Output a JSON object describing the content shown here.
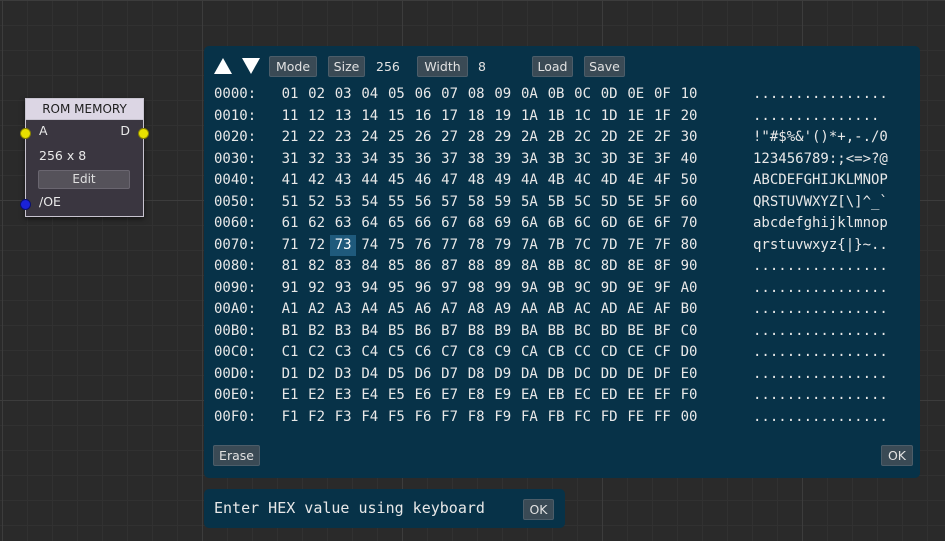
{
  "rom_node": {
    "title": "ROM MEMORY",
    "pin_a": "A",
    "pin_d": "D",
    "size_label": "256 x 8",
    "edit_button": "Edit",
    "pin_oe": "/OE"
  },
  "toolbar": {
    "mode_button": "Mode",
    "size_button": "Size",
    "size_value": "256",
    "width_button": "Width",
    "width_value": "8",
    "load_button": "Load",
    "save_button": "Save"
  },
  "hex_rows": [
    {
      "addr": "0000:",
      "bytes": [
        "01",
        "02",
        "03",
        "04",
        "05",
        "06",
        "07",
        "08",
        "09",
        "0A",
        "0B",
        "0C",
        "0D",
        "0E",
        "0F",
        "10"
      ],
      "ascii": "................"
    },
    {
      "addr": "0010:",
      "bytes": [
        "11",
        "12",
        "13",
        "14",
        "15",
        "16",
        "17",
        "18",
        "19",
        "1A",
        "1B",
        "1C",
        "1D",
        "1E",
        "1F",
        "20"
      ],
      "ascii": "............... "
    },
    {
      "addr": "0020:",
      "bytes": [
        "21",
        "22",
        "23",
        "24",
        "25",
        "26",
        "27",
        "28",
        "29",
        "2A",
        "2B",
        "2C",
        "2D",
        "2E",
        "2F",
        "30"
      ],
      "ascii": "!\"#$%&'()*+,-./0"
    },
    {
      "addr": "0030:",
      "bytes": [
        "31",
        "32",
        "33",
        "34",
        "35",
        "36",
        "37",
        "38",
        "39",
        "3A",
        "3B",
        "3C",
        "3D",
        "3E",
        "3F",
        "40"
      ],
      "ascii": "123456789:;<=>?@"
    },
    {
      "addr": "0040:",
      "bytes": [
        "41",
        "42",
        "43",
        "44",
        "45",
        "46",
        "47",
        "48",
        "49",
        "4A",
        "4B",
        "4C",
        "4D",
        "4E",
        "4F",
        "50"
      ],
      "ascii": "ABCDEFGHIJKLMNOP"
    },
    {
      "addr": "0050:",
      "bytes": [
        "51",
        "52",
        "53",
        "54",
        "55",
        "56",
        "57",
        "58",
        "59",
        "5A",
        "5B",
        "5C",
        "5D",
        "5E",
        "5F",
        "60"
      ],
      "ascii": "QRSTUVWXYZ[\\]^_`"
    },
    {
      "addr": "0060:",
      "bytes": [
        "61",
        "62",
        "63",
        "64",
        "65",
        "66",
        "67",
        "68",
        "69",
        "6A",
        "6B",
        "6C",
        "6D",
        "6E",
        "6F",
        "70"
      ],
      "ascii": "abcdefghijklmnop"
    },
    {
      "addr": "0070:",
      "bytes": [
        "71",
        "72",
        "73",
        "74",
        "75",
        "76",
        "77",
        "78",
        "79",
        "7A",
        "7B",
        "7C",
        "7D",
        "7E",
        "7F",
        "80"
      ],
      "ascii": "qrstuvwxyz{|}~.."
    },
    {
      "addr": "0080:",
      "bytes": [
        "81",
        "82",
        "83",
        "84",
        "85",
        "86",
        "87",
        "88",
        "89",
        "8A",
        "8B",
        "8C",
        "8D",
        "8E",
        "8F",
        "90"
      ],
      "ascii": "................"
    },
    {
      "addr": "0090:",
      "bytes": [
        "91",
        "92",
        "93",
        "94",
        "95",
        "96",
        "97",
        "98",
        "99",
        "9A",
        "9B",
        "9C",
        "9D",
        "9E",
        "9F",
        "A0"
      ],
      "ascii": "................"
    },
    {
      "addr": "00A0:",
      "bytes": [
        "A1",
        "A2",
        "A3",
        "A4",
        "A5",
        "A6",
        "A7",
        "A8",
        "A9",
        "AA",
        "AB",
        "AC",
        "AD",
        "AE",
        "AF",
        "B0"
      ],
      "ascii": "................"
    },
    {
      "addr": "00B0:",
      "bytes": [
        "B1",
        "B2",
        "B3",
        "B4",
        "B5",
        "B6",
        "B7",
        "B8",
        "B9",
        "BA",
        "BB",
        "BC",
        "BD",
        "BE",
        "BF",
        "C0"
      ],
      "ascii": "................"
    },
    {
      "addr": "00C0:",
      "bytes": [
        "C1",
        "C2",
        "C3",
        "C4",
        "C5",
        "C6",
        "C7",
        "C8",
        "C9",
        "CA",
        "CB",
        "CC",
        "CD",
        "CE",
        "CF",
        "D0"
      ],
      "ascii": "................"
    },
    {
      "addr": "00D0:",
      "bytes": [
        "D1",
        "D2",
        "D3",
        "D4",
        "D5",
        "D6",
        "D7",
        "D8",
        "D9",
        "DA",
        "DB",
        "DC",
        "DD",
        "DE",
        "DF",
        "E0"
      ],
      "ascii": "................"
    },
    {
      "addr": "00E0:",
      "bytes": [
        "E1",
        "E2",
        "E3",
        "E4",
        "E5",
        "E6",
        "E7",
        "E8",
        "E9",
        "EA",
        "EB",
        "EC",
        "ED",
        "EE",
        "EF",
        "F0"
      ],
      "ascii": "................"
    },
    {
      "addr": "00F0:",
      "bytes": [
        "F1",
        "F2",
        "F3",
        "F4",
        "F5",
        "F6",
        "F7",
        "F8",
        "F9",
        "FA",
        "FB",
        "FC",
        "FD",
        "FE",
        "FF",
        "00"
      ],
      "ascii": "................"
    }
  ],
  "selected_byte": "73",
  "footer": {
    "erase_button": "Erase",
    "ok_button": "OK"
  },
  "status": {
    "text": "Enter HEX value using keyboard",
    "ok_button": "OK"
  },
  "colors": {
    "panel_bg": "#073248",
    "selection": "#1f5a7c",
    "pin_yellow": "#e8e000",
    "pin_blue": "#1a22d8"
  }
}
